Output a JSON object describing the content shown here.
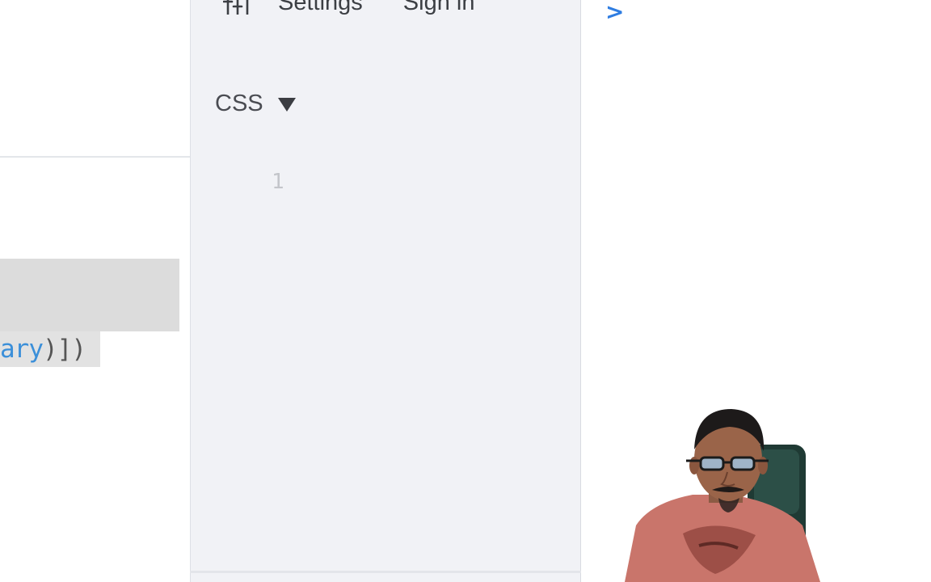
{
  "toolbar": {
    "settings_label": "Settings",
    "sign_in_label": "Sign in",
    "settings_icon": "sliders-icon"
  },
  "css_panel": {
    "language_label": "CSS",
    "line_numbers": [
      "1"
    ]
  },
  "code_pane": {
    "visible_line_ident": "ary",
    "visible_line_punct": ")])"
  },
  "output_pane": {
    "prompt_glyph": ">"
  },
  "colors": {
    "panel_bg": "#f1f2f6",
    "accent": "#2f7de1",
    "identifier": "#3b8fd9",
    "highlight": "#dcdcdc"
  }
}
